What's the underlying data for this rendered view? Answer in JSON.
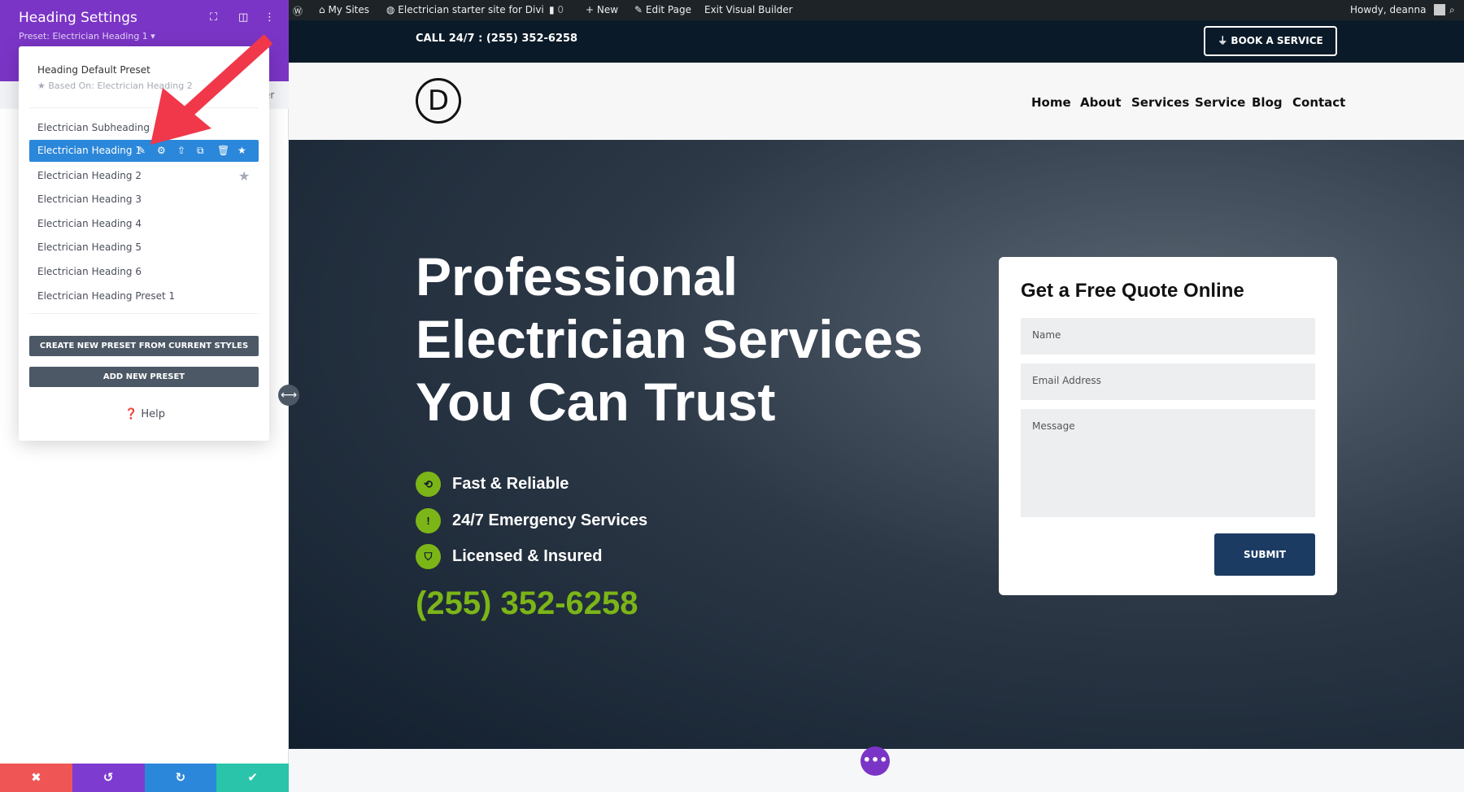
{
  "panel": {
    "title": "Heading Settings",
    "preset_label": "Preset: Electrician Heading 1 ▾",
    "tab_partial": "er",
    "dropdown": {
      "default_preset": "Heading Default Preset",
      "based_on": "Based On: Electrician Heading 2",
      "presets": [
        "Electrician Subheading",
        "Electrician Heading 1",
        "Electrician Heading 2",
        "Electrician Heading 3",
        "Electrician Heading 4",
        "Electrician Heading 5",
        "Electrician Heading 6",
        "Electrician Heading Preset 1"
      ],
      "create_btn": "CREATE NEW PRESET FROM CURRENT STYLES",
      "add_btn": "ADD NEW PRESET",
      "help": "Help"
    },
    "bottom_colors": [
      "#ef5555",
      "#7e3bd0",
      "#2b87da",
      "#29c4a9"
    ]
  },
  "admin": {
    "my_sites": "My Sites",
    "site": "Electrician starter site for Divi",
    "comments": "0",
    "new": "New",
    "edit": "Edit Page",
    "exit": "Exit Visual Builder",
    "howdy": "Howdy, deanna"
  },
  "site": {
    "call": "CALL 24/7 : (255) 352-6258",
    "book": "BOOK A SERVICE",
    "logo": "D",
    "nav": [
      "Home",
      "About",
      "Services",
      "Service",
      "Blog",
      "Contact"
    ],
    "hero_lines": [
      "Professional",
      "Electrician Services",
      "You Can Trust"
    ],
    "features": [
      "Fast & Reliable",
      "24/7 Emergency Services",
      "Licensed & Insured"
    ],
    "phone": "(255) 352-6258",
    "accent": "#7cb518",
    "form": {
      "title": "Get a Free Quote Online",
      "name": "Name",
      "email": "Email Address",
      "message": "Message",
      "submit": "SUBMIT"
    }
  }
}
